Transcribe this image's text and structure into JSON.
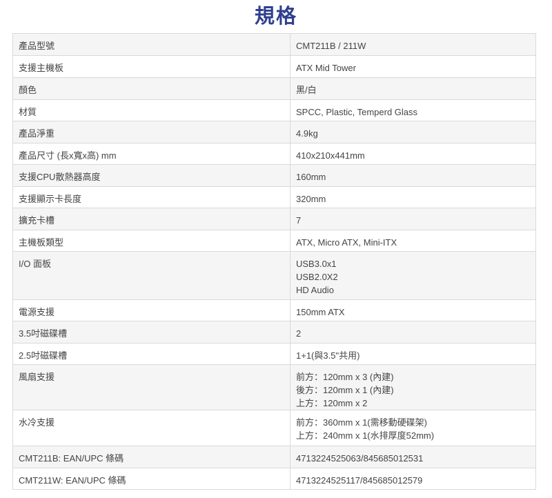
{
  "page": {
    "title": "規格"
  },
  "spec_rows": [
    {
      "label": "產品型號",
      "value": [
        "CMT211B / 211W"
      ]
    },
    {
      "label": "支援主機板",
      "value": [
        "ATX Mid Tower"
      ]
    },
    {
      "label": "顏色",
      "value": [
        "黑/白"
      ]
    },
    {
      "label": "材質",
      "value": [
        "SPCC, Plastic, Temperd Glass"
      ]
    },
    {
      "label": "產品淨重",
      "value": [
        "4.9kg"
      ]
    },
    {
      "label": "產品尺寸 (長x寬x高) mm",
      "value": [
        "410x210x441mm"
      ]
    },
    {
      "label": "支援CPU散熱器高度",
      "value": [
        "160mm"
      ]
    },
    {
      "label": "支援顯示卡長度",
      "value": [
        "320mm"
      ]
    },
    {
      "label": "擴充卡槽",
      "value": [
        "7"
      ]
    },
    {
      "label": "主機板類型",
      "value": [
        "ATX, Micro ATX, Mini-ITX"
      ]
    },
    {
      "label": "I/O 面板",
      "value": [
        "USB3.0x1",
        "USB2.0X2",
        "HD Audio"
      ]
    },
    {
      "label": "電源支援",
      "value": [
        "150mm ATX"
      ]
    },
    {
      "label": "3.5吋磁碟槽",
      "value": [
        "2"
      ]
    },
    {
      "label": "2.5吋磁碟槽",
      "value": [
        "1+1(與3.5\"共用)"
      ]
    },
    {
      "label": "風扇支援",
      "value": [
        "前方：120mm x 3 (內建)",
        "後方：120mm x 1 (內建)",
        "上方：120mm x 2"
      ]
    },
    {
      "label": "水冷支援",
      "value": [
        "前方：360mm x 1(需移動硬碟架)",
        "上方：240mm x 1(水排厚度52mm)"
      ]
    },
    {
      "label": "CMT211B: EAN/UPC 條碼",
      "value": [
        "4713224525063/845685012531"
      ]
    },
    {
      "label": "CMT211W: EAN/UPC 條碼",
      "value": [
        "4713224525117/845685012579"
      ]
    }
  ]
}
